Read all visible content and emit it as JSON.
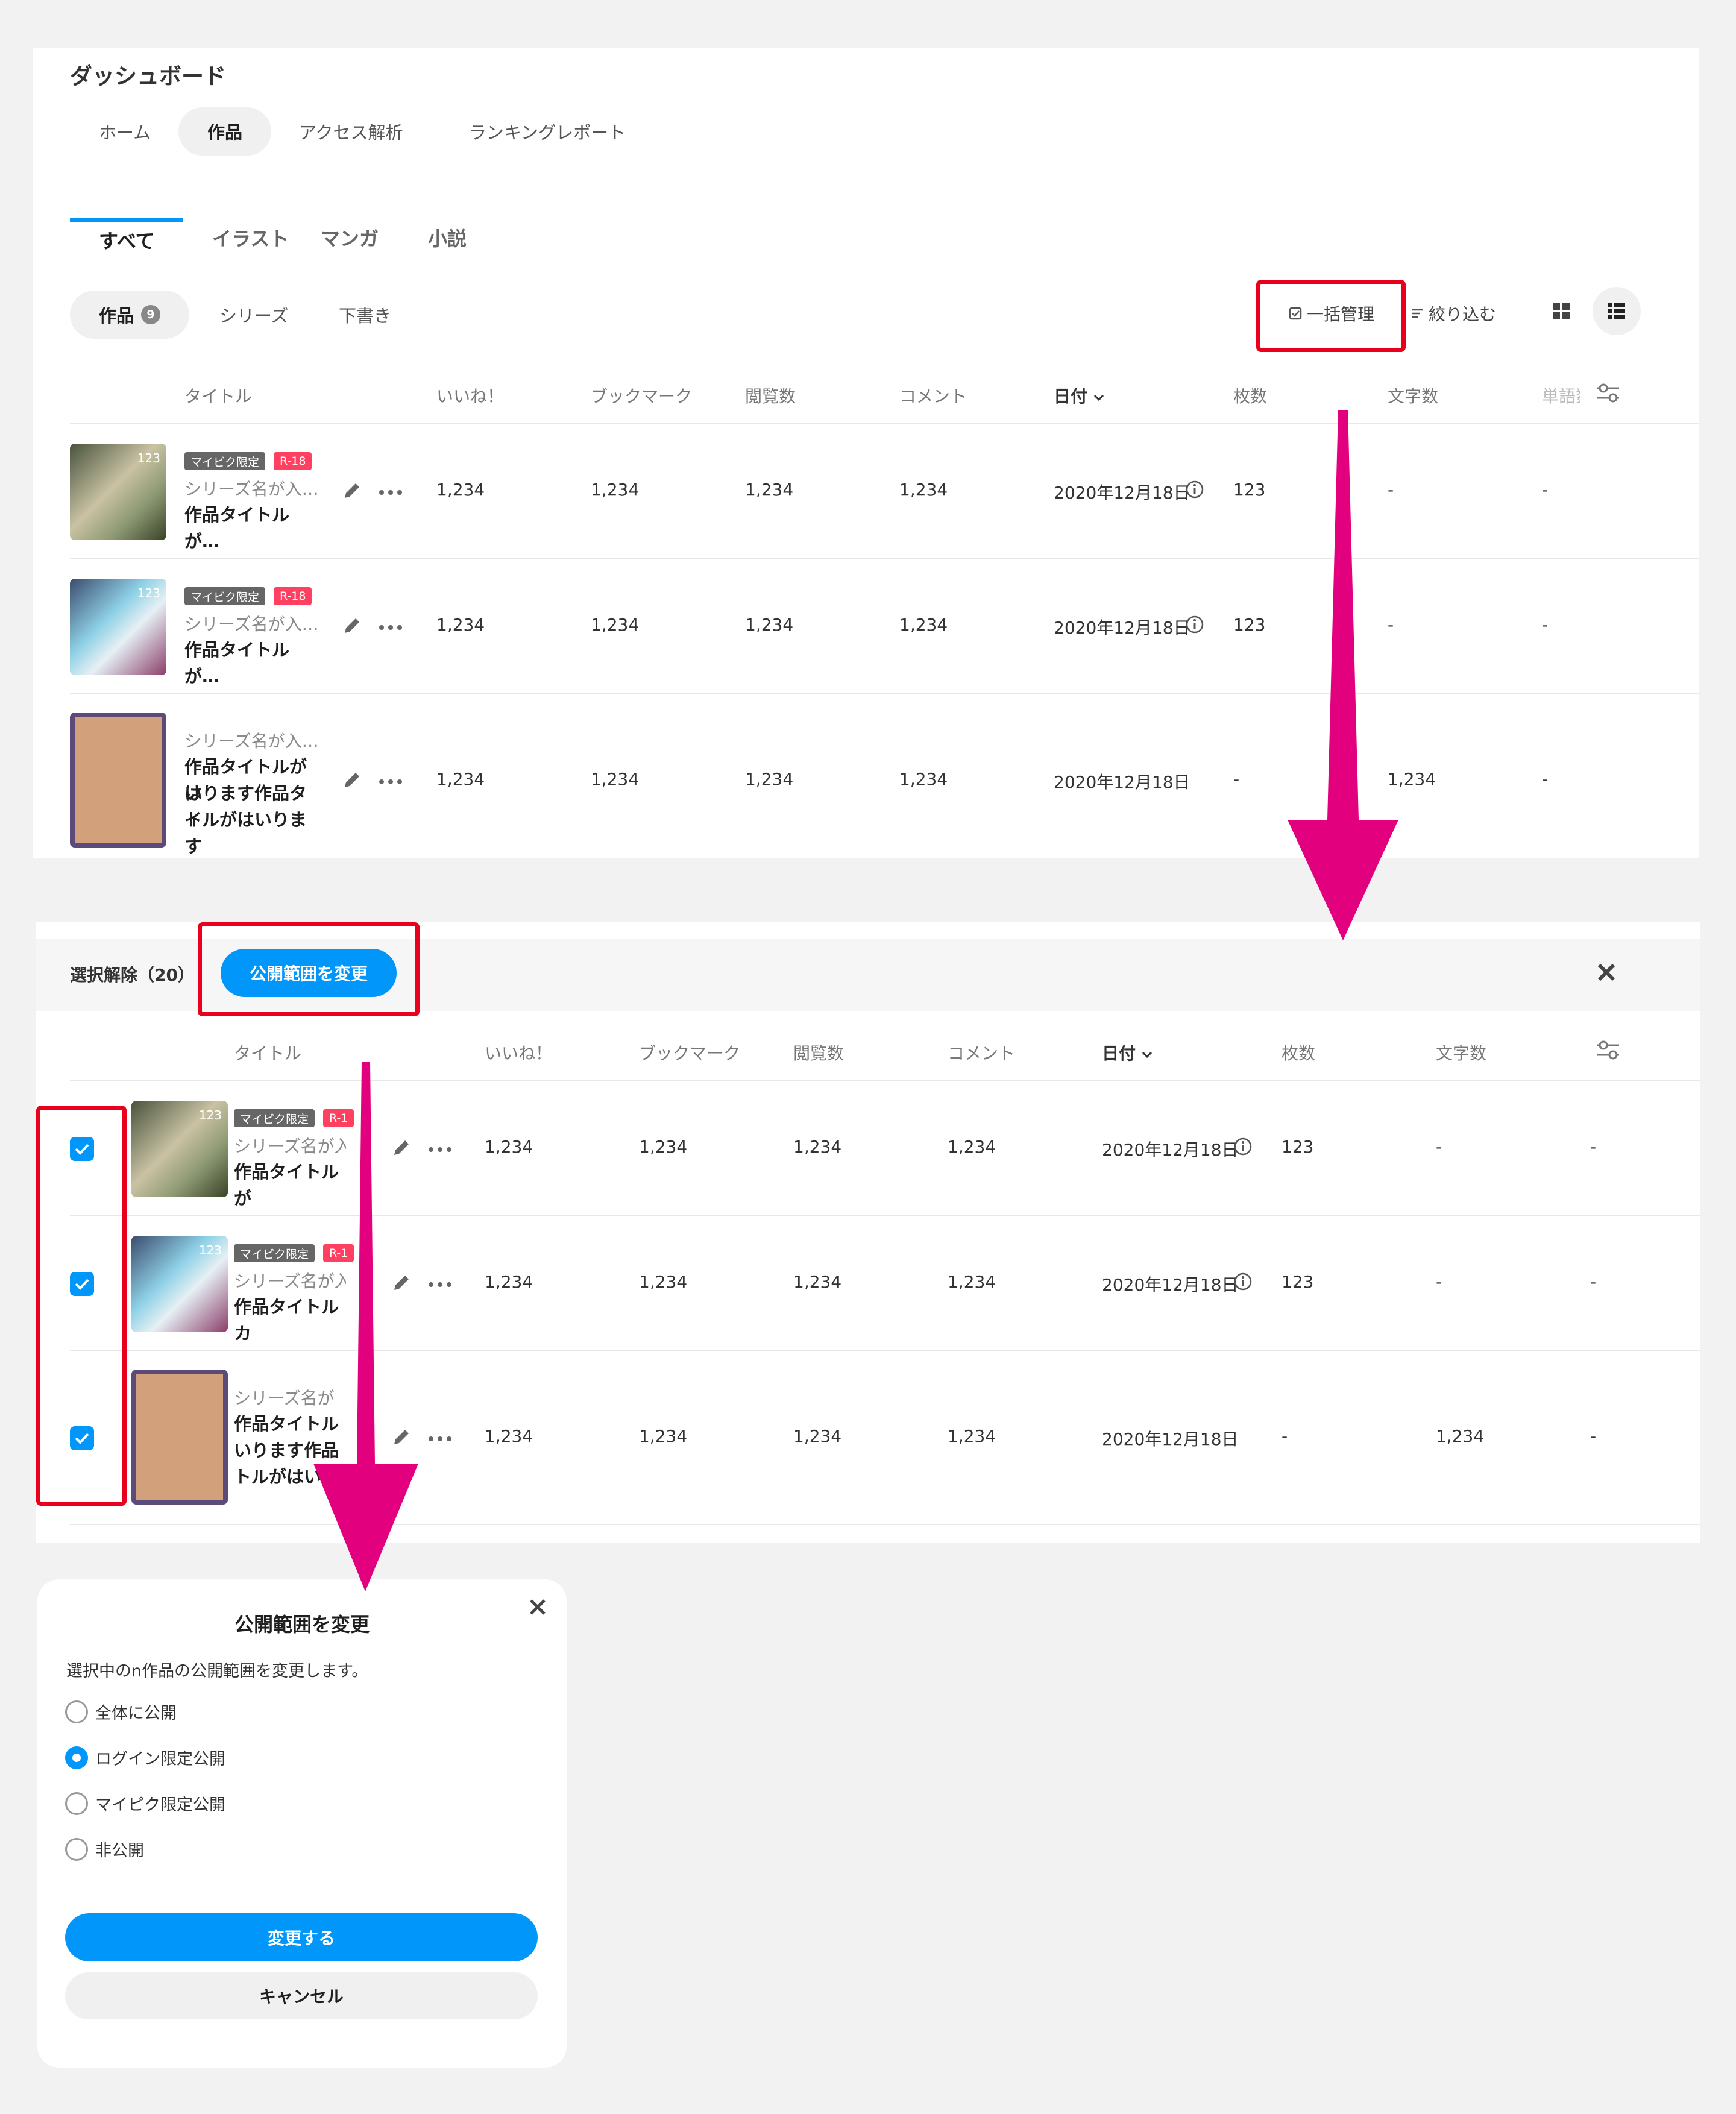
{
  "dashboard": {
    "title": "ダッシュボード",
    "nav_tabs": [
      "ホーム",
      "作品",
      "アクセス解析",
      "ランキングレポート"
    ],
    "content_tabs": [
      "すべて",
      "イラスト",
      "マンガ",
      "小説"
    ],
    "pills": [
      {
        "label": "作品",
        "count": "9"
      },
      {
        "label": "シリーズ"
      },
      {
        "label": "下書き"
      }
    ],
    "bulk_manage": "一括管理",
    "filter": "絞り込む"
  },
  "table": {
    "headers": [
      "タイトル",
      "いいね！",
      "ブックマーク",
      "閲覧数",
      "コメント",
      "日付",
      "枚数",
      "文字数",
      "単語数"
    ],
    "rows": [
      {
        "tags": [
          "マイピク限定",
          "R-18"
        ],
        "count": "123",
        "series": "シリーズ名が入…",
        "title": "作品タイトルが…",
        "likes": "1,234",
        "bookmarks": "1,234",
        "views": "1,234",
        "comments": "1,234",
        "date": "2020年12月18日",
        "pages": "123",
        "chars": "-",
        "words": "-"
      },
      {
        "tags": [
          "マイピク限定",
          "R-18"
        ],
        "count": "123",
        "series": "シリーズ名が入…",
        "title": "作品タイトルが…",
        "likes": "1,234",
        "bookmarks": "1,234",
        "views": "1,234",
        "comments": "1,234",
        "date": "2020年12月18日",
        "pages": "123",
        "chars": "-",
        "words": "-"
      },
      {
        "tags": [],
        "count": "",
        "series": "シリーズ名が入…",
        "title_lines": [
          "作品タイトルがは",
          "いります作品タイ",
          "トルがはいります"
        ],
        "likes": "1,234",
        "bookmarks": "1,234",
        "views": "1,234",
        "comments": "1,234",
        "date": "2020年12月18日",
        "pages": "-",
        "chars": "1,234",
        "words": "-"
      }
    ]
  },
  "bulk": {
    "deselect": "選択解除（20）",
    "change_button": "公開範囲を変更",
    "headers": [
      "タイトル",
      "いいね！",
      "ブックマーク",
      "閲覧数",
      "コメント",
      "日付",
      "枚数",
      "文字数"
    ],
    "rows": [
      {
        "tags": [
          "マイピク限定",
          "R-1"
        ],
        "count": "123",
        "series": "シリーズ名が入",
        "title": "作品タイトルが",
        "likes": "1,234",
        "bookmarks": "1,234",
        "views": "1,234",
        "comments": "1,234",
        "date": "2020年12月18日",
        "pages": "123",
        "chars": "-",
        "extra": "-"
      },
      {
        "tags": [
          "マイピク限定",
          "R-1"
        ],
        "count": "123",
        "series": "シリーズ名が入",
        "title": "作品タイトルカ",
        "likes": "1,234",
        "bookmarks": "1,234",
        "views": "1,234",
        "comments": "1,234",
        "date": "2020年12月18日",
        "pages": "123",
        "chars": "-",
        "extra": "-"
      },
      {
        "tags": [],
        "count": "",
        "series": "シリーズ名が",
        "title_lines": [
          "作品タイトル",
          "いります作品",
          "トルがはい"
        ],
        "likes": "1,234",
        "bookmarks": "1,234",
        "views": "1,234",
        "comments": "1,234",
        "date": "2020年12月18日",
        "pages": "-",
        "chars": "1,234",
        "extra": "-"
      }
    ]
  },
  "modal": {
    "title": "公開範囲を変更",
    "description": "選択中のn作品の公開範囲を変更します。",
    "options": [
      "全体に公開",
      "ログイン限定公開",
      "マイピク限定公開",
      "非公開"
    ],
    "selected_option": "ログイン限定公開",
    "submit": "変更する",
    "cancel": "キャンセル"
  },
  "colors": {
    "accent": "#0096fa",
    "highlight": "#e8001c",
    "arrow": "#e3007f",
    "r18": "#ff4060"
  },
  "icons": [
    "checklist-icon",
    "filter-icon",
    "grid-view-icon",
    "list-view-icon",
    "pencil-icon",
    "more-icon",
    "info-icon",
    "sort-chevron-icon",
    "column-settings-icon",
    "close-icon",
    "check-icon"
  ]
}
